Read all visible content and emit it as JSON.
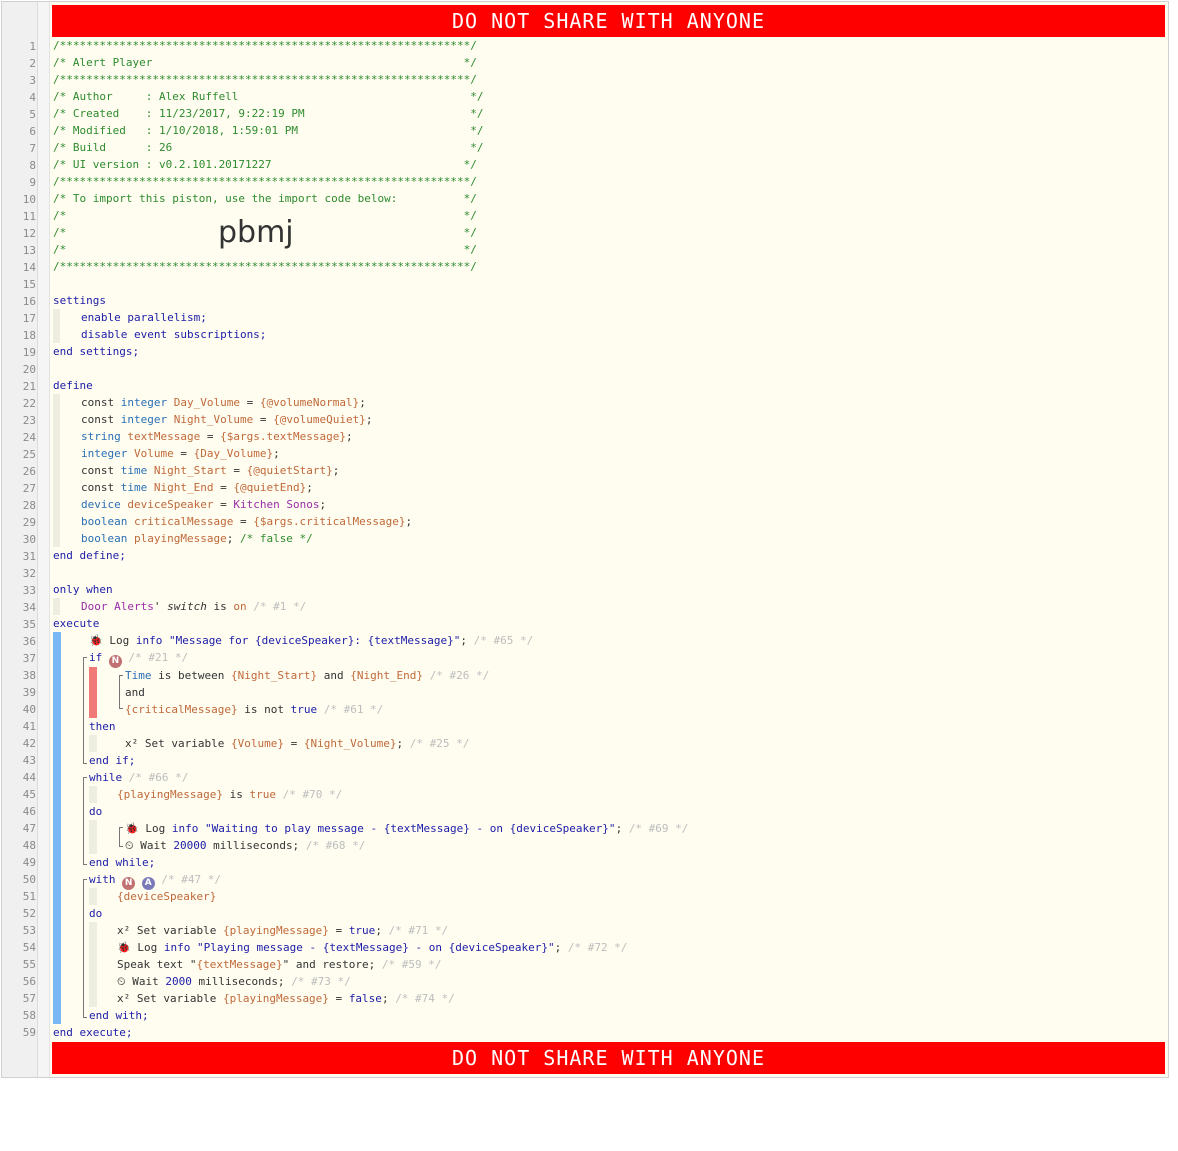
{
  "banner": {
    "text": "DO NOT SHARE WITH ANYONE"
  },
  "header": {
    "border": "/**************************************************************/",
    "title": "/* Alert Player                                               */",
    "author": "/* Author     : Alex Ruffell                                   */",
    "created": "/* Created    : 11/23/2017, 9:22:19 PM                         */",
    "modified": "/* Modified   : 1/10/2018, 1:59:01 PM                          */",
    "build": "/* Build      : 26                                             */",
    "ui_version": "/* UI version : v0.2.101.20171227                             */",
    "import_note": "/* To import this piston, use the import code below:          */",
    "blank": "/*                                                            */",
    "import_code": "pbmj"
  },
  "code": {
    "settings": "settings",
    "enable_parallelism": "enable parallelism;",
    "disable_subs": "disable event subscriptions;",
    "end_settings": "end settings;",
    "define": "define",
    "end_define": "end define;",
    "only_when": "only when",
    "door_alerts": "Door Alerts",
    "switch": "switch",
    "execute": "execute",
    "end_execute": "end execute;",
    "if": "if",
    "then": "then",
    "end_if": "end if;",
    "while": "while",
    "do": "do",
    "end_while": "end while;",
    "with": "with",
    "end_with": "end with;",
    "and": "and"
  },
  "defines": [
    {
      "pre": "const ",
      "type": "integer",
      "name": "Day_Volume",
      "val": "{@volumeNormal}"
    },
    {
      "pre": "const ",
      "type": "integer",
      "name": "Night_Volume",
      "val": "{@volumeQuiet}"
    },
    {
      "pre": "",
      "type": "string",
      "name": "textMessage",
      "val": "{$args.textMessage}"
    },
    {
      "pre": "",
      "type": "integer",
      "name": "Volume",
      "val": "{Day_Volume}"
    },
    {
      "pre": "const ",
      "type": "time",
      "name": "Night_Start",
      "val": "{@quietStart}"
    },
    {
      "pre": "const ",
      "type": "time",
      "name": "Night_End",
      "val": "{@quietEnd}"
    },
    {
      "pre": "",
      "type": "device",
      "name": "deviceSpeaker",
      "val": "Kitchen Sonos"
    },
    {
      "pre": "",
      "type": "boolean",
      "name": "criticalMessage",
      "val": "{$args.criticalMessage}"
    },
    {
      "pre": "",
      "type": "boolean",
      "name": "playingMessage",
      "val": ""
    }
  ],
  "statements": {
    "log1_str": "\"Message for {deviceSpeaker}: {textMessage}\"",
    "log2_str": "\"Waiting to play message - {textMessage} - on {deviceSpeaker}\"",
    "log3_str": "\"Playing message - {textMessage} - on {deviceSpeaker}\"",
    "wait1": "20000",
    "wait2": "2000"
  },
  "colors": {
    "banner": "#ff0000",
    "paper": "#fffdf0",
    "block_bar": "#7ab8f5",
    "condition_bar": "#f07a78"
  }
}
